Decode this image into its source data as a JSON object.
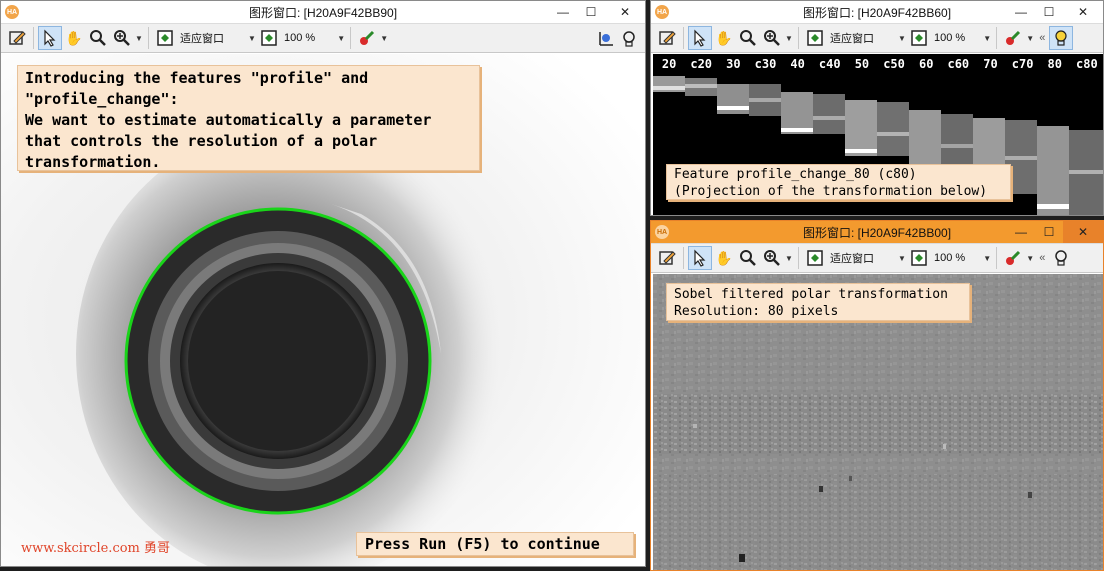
{
  "left_window": {
    "title": "图形窗口: [H20A9F42BB90]",
    "zoom_mode": "适应窗口",
    "zoom_pct": "100 %",
    "note": "Introducing the features \"profile\" and\n\"profile_change\":\nWe want to estimate automatically a parameter\nthat controls the resolution of a polar\ntransformation.",
    "continue_label": "Press Run (F5) to continue",
    "watermark": "www.skcircle.com 勇哥"
  },
  "top_right_window": {
    "title": "图形窗口: [H20A9F42BB60]",
    "zoom_mode": "适应窗口",
    "zoom_pct": "100 %",
    "overflow": "«",
    "profile_labels": [
      "20",
      "c20",
      "30",
      "c30",
      "40",
      "c40",
      "50",
      "c50",
      "60",
      "c60",
      "70",
      "c70",
      "80",
      "c80"
    ],
    "note": "Feature profile_change_80 (c80)\n(Projection of the transformation below)"
  },
  "bottom_right_window": {
    "title": "图形窗口: [H20A9F42BB00]",
    "zoom_mode": "适应窗口",
    "zoom_pct": "100 %",
    "overflow": "«",
    "note": "Sobel filtered polar transformation\nResolution: 80 pixels"
  },
  "controls": {
    "minimize": "—",
    "maximize": "☐",
    "close": "✕"
  },
  "colors": {
    "active_title": "#f39a2e",
    "circle": "#19d419",
    "note_bg": "#fbe6cf",
    "watermark": "#e0452a"
  }
}
